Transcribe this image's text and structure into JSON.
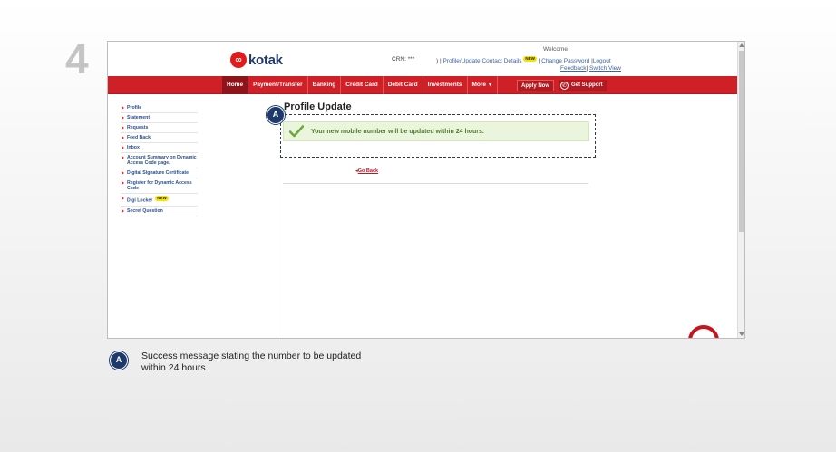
{
  "step": "4",
  "header": {
    "logo_text": "kotak",
    "crn_label": "CRN:",
    "crn_value": "***",
    "profile_link": "Profile/Update Contact Details",
    "new_badge": "NEW",
    "change_password": "Change Password",
    "logout": "Logout",
    "welcome": "Welcome",
    "feedback": "Feedback",
    "switch_view": "Switch View"
  },
  "nav": {
    "items": [
      "Home",
      "Payment/Transfer",
      "Banking",
      "Credit Card",
      "Debit Card",
      "Investments",
      "More"
    ],
    "apply_now": "Apply Now",
    "get_support": "Get Support"
  },
  "sidebar": {
    "items": [
      "Profile",
      "Statement",
      "Requests",
      "Feed Back",
      "Inbox",
      "Account Summary on Dynamic Access Code page.",
      "Digital Signature Certificate",
      "Register for Dynamic Access Code",
      "Digi Locker",
      "Secret Question"
    ]
  },
  "content": {
    "title": "Profile Update",
    "success_message": "Your new mobile number will be updated within 24 hours.",
    "go_back": "Go Back"
  },
  "annotation": {
    "marker": "A",
    "text": "Success message stating the number to be updated within 24 hours"
  },
  "colors": {
    "nav_red": "#cf2027",
    "success_bg": "#ebf5dd",
    "success_text": "#4f7c2c",
    "badge_navy": "#1d3a6b"
  }
}
